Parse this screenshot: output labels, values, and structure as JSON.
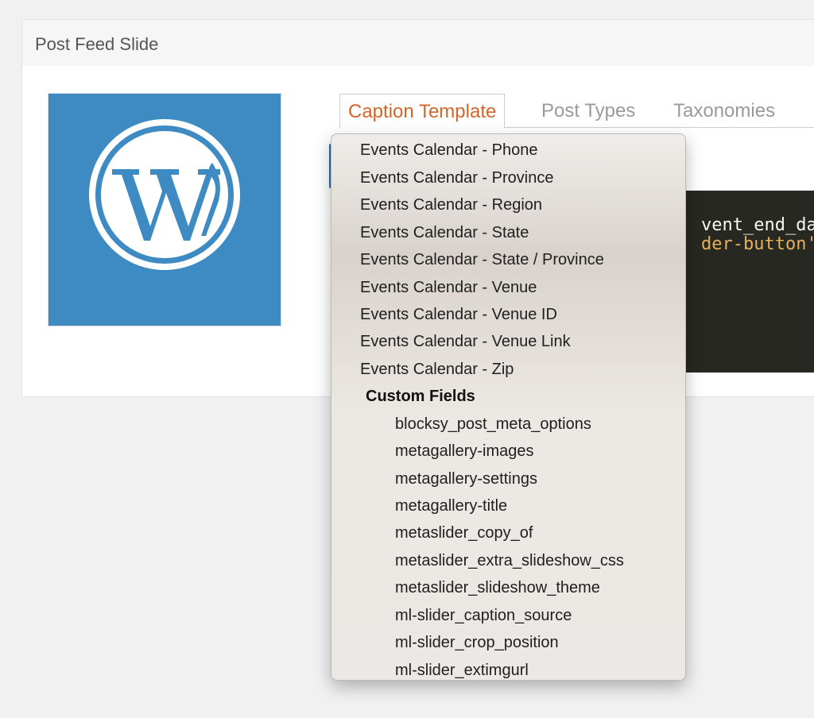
{
  "panel": {
    "title": "Post Feed Slide"
  },
  "thumbnail": {
    "icon": "wordpress-logo-icon",
    "bg_color": "#3e8ac2"
  },
  "tabs": [
    {
      "label": "Caption Template",
      "active": true
    },
    {
      "label": "Post Types",
      "active": false
    },
    {
      "label": "Taxonomies",
      "active": false
    }
  ],
  "code_editor": {
    "line1": "vent_end_dat",
    "line2": "der-button'>"
  },
  "dropdown": {
    "items": [
      "Events Calendar - Phone",
      "Events Calendar - Province",
      "Events Calendar - Region",
      "Events Calendar - State",
      "Events Calendar - State / Province",
      "Events Calendar - Venue",
      "Events Calendar - Venue ID",
      "Events Calendar - Venue Link",
      "Events Calendar - Zip"
    ],
    "group_label": "Custom Fields",
    "custom_fields": [
      "blocksy_post_meta_options",
      "metagallery-images",
      "metagallery-settings",
      "metagallery-title",
      "metaslider_copy_of",
      "metaslider_extra_slideshow_css",
      "metaslider_slideshow_theme",
      "ml-slider_caption_source",
      "ml-slider_crop_position",
      "ml-slider_extimgurl"
    ]
  },
  "colors": {
    "accent": "#d3652a",
    "code_bg": "#272822",
    "code_string": "#e6b15b",
    "wp_blue": "#2271b1"
  }
}
